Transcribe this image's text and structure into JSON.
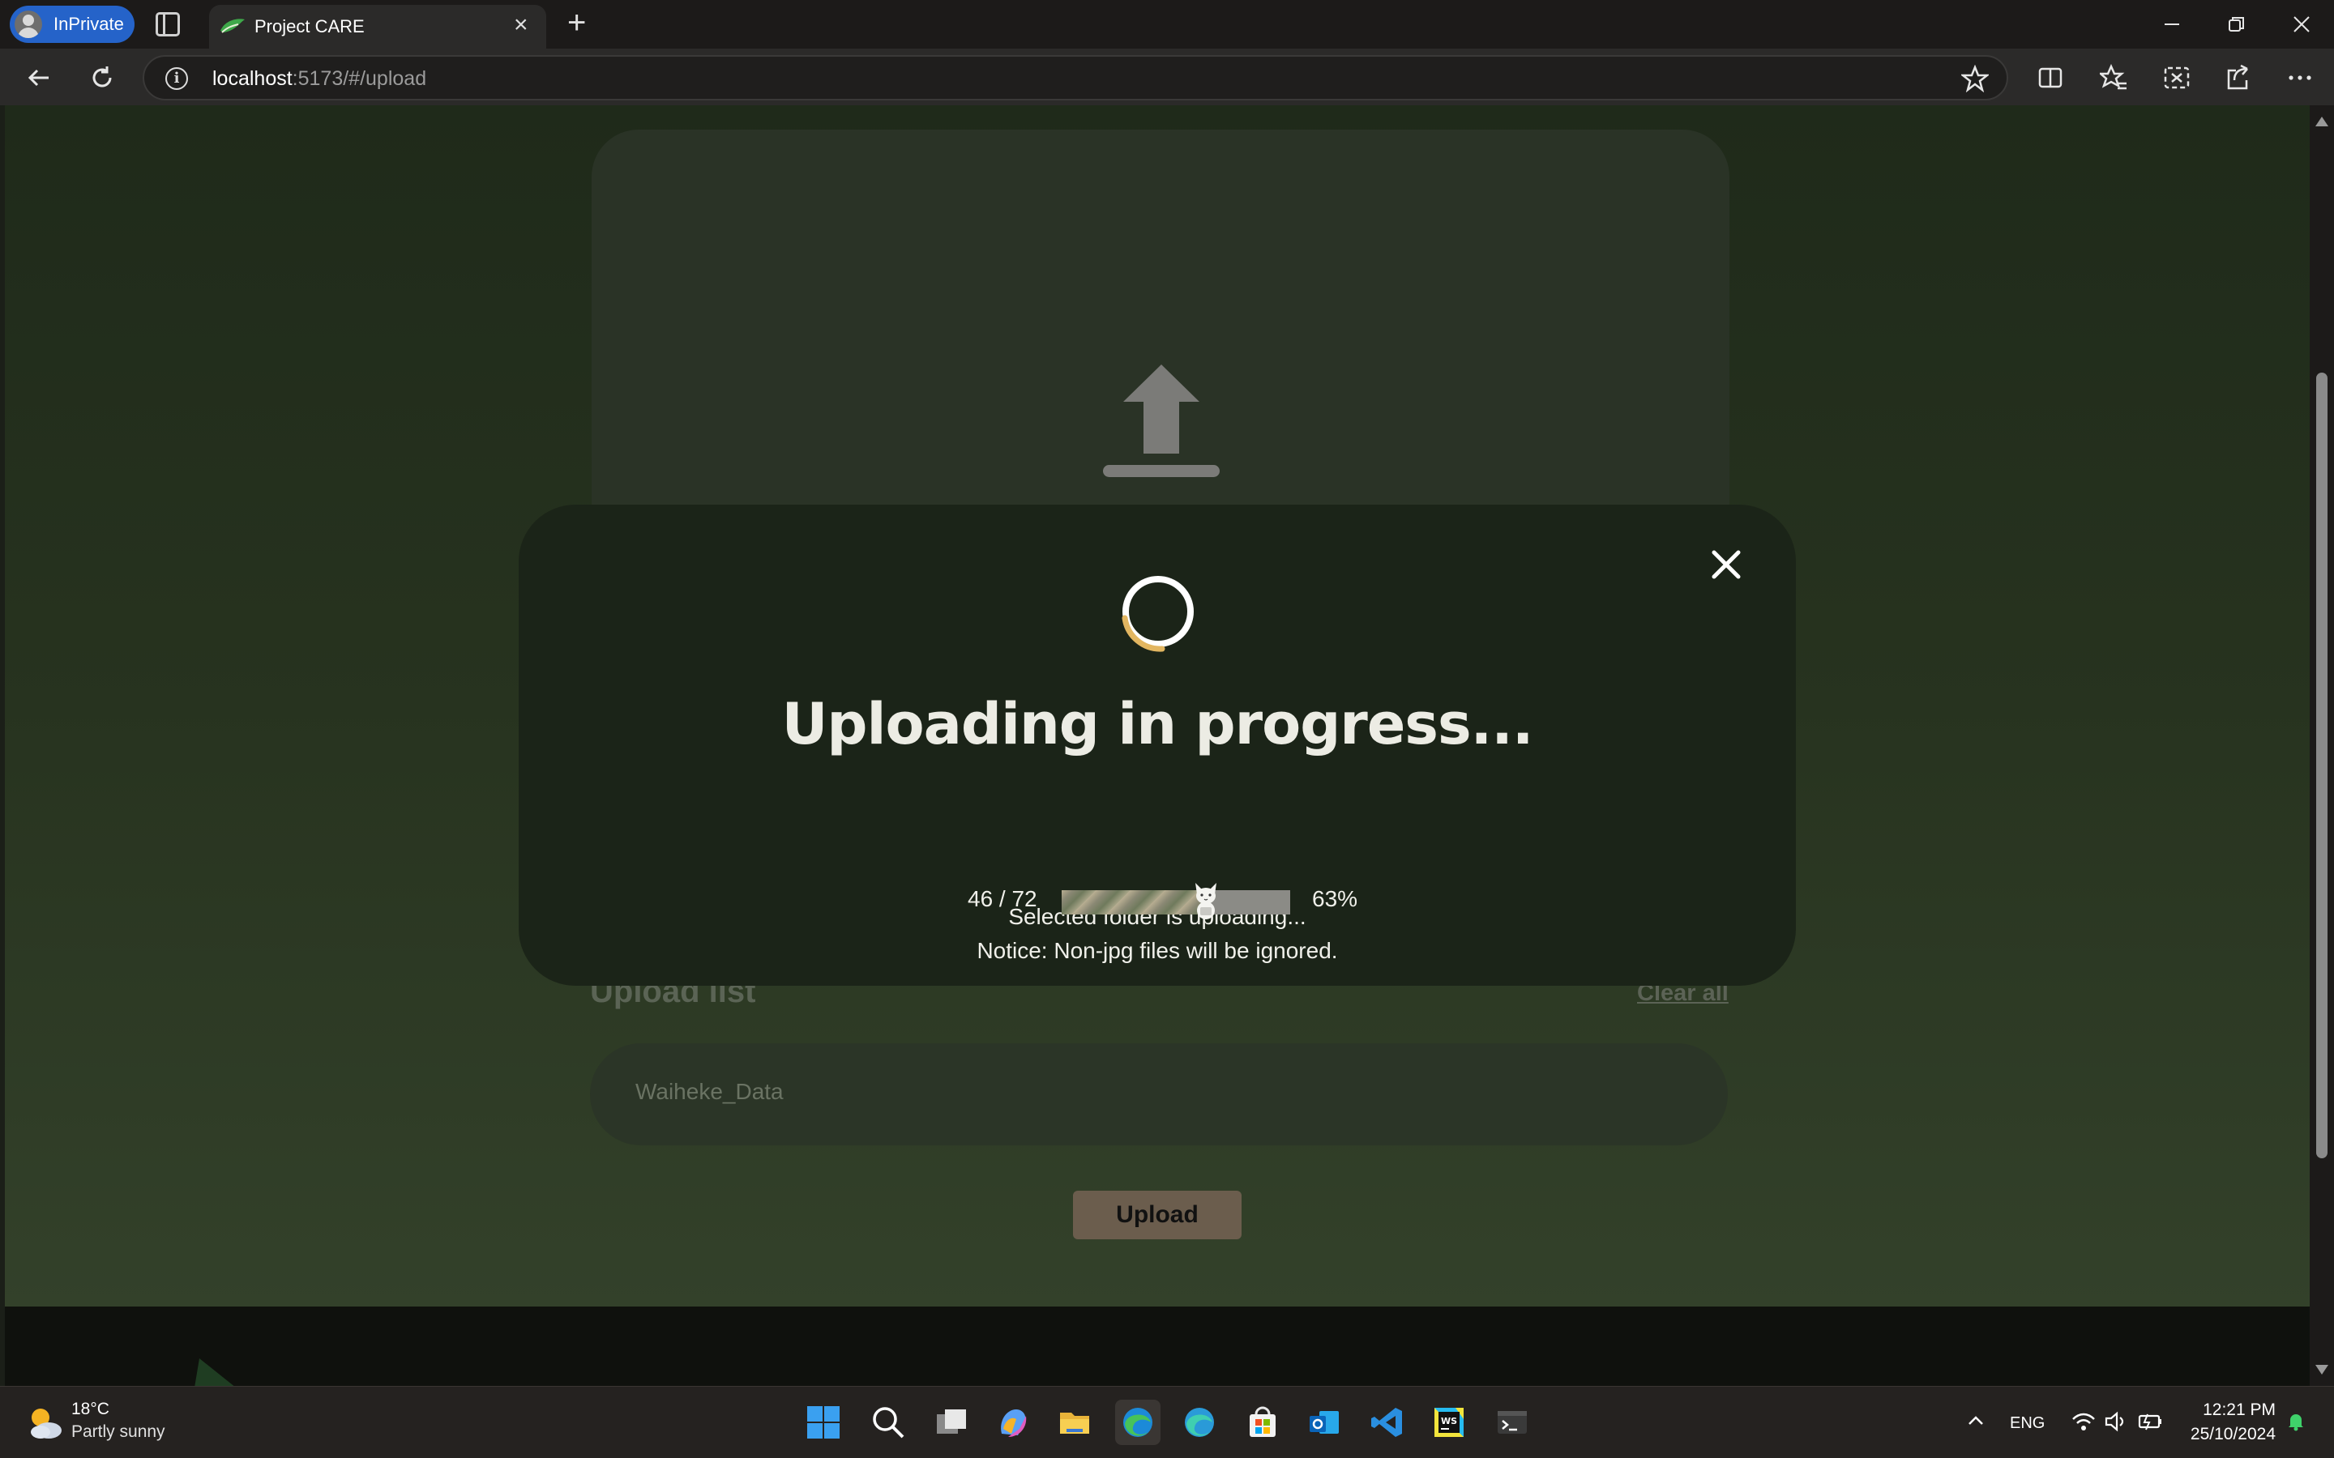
{
  "browser": {
    "profile_label": "InPrivate",
    "tab_title": "Project CARE",
    "url_host": "localhost",
    "url_rest": ":5173/#/upload"
  },
  "upload_page": {
    "list_title": "Upload list",
    "clear_all_label": "Clear all",
    "items": [
      "Waiheke_Data"
    ],
    "upload_button_label": "Upload"
  },
  "modal": {
    "title": "Uploading in progress...",
    "message_line1": "Selected folder is uploading...",
    "message_line2": "Notice: Non-jpg files will be ignored.",
    "count_text": "46 / 72",
    "percent_text": "63%",
    "progress_fraction": 0.63,
    "accent_color": "#e2b661"
  },
  "taskbar": {
    "weather_temp": "18°C",
    "weather_desc": "Partly sunny",
    "language": "ENG",
    "time": "12:21 PM",
    "date": "25/10/2024",
    "apps": [
      "start-icon",
      "search-icon",
      "task-view-icon",
      "copilot-icon",
      "file-explorer-icon",
      "edge-icon",
      "edge-beta-icon",
      "store-icon",
      "outlook-icon",
      "vscode-icon",
      "webstorm-icon",
      "terminal-icon"
    ]
  }
}
